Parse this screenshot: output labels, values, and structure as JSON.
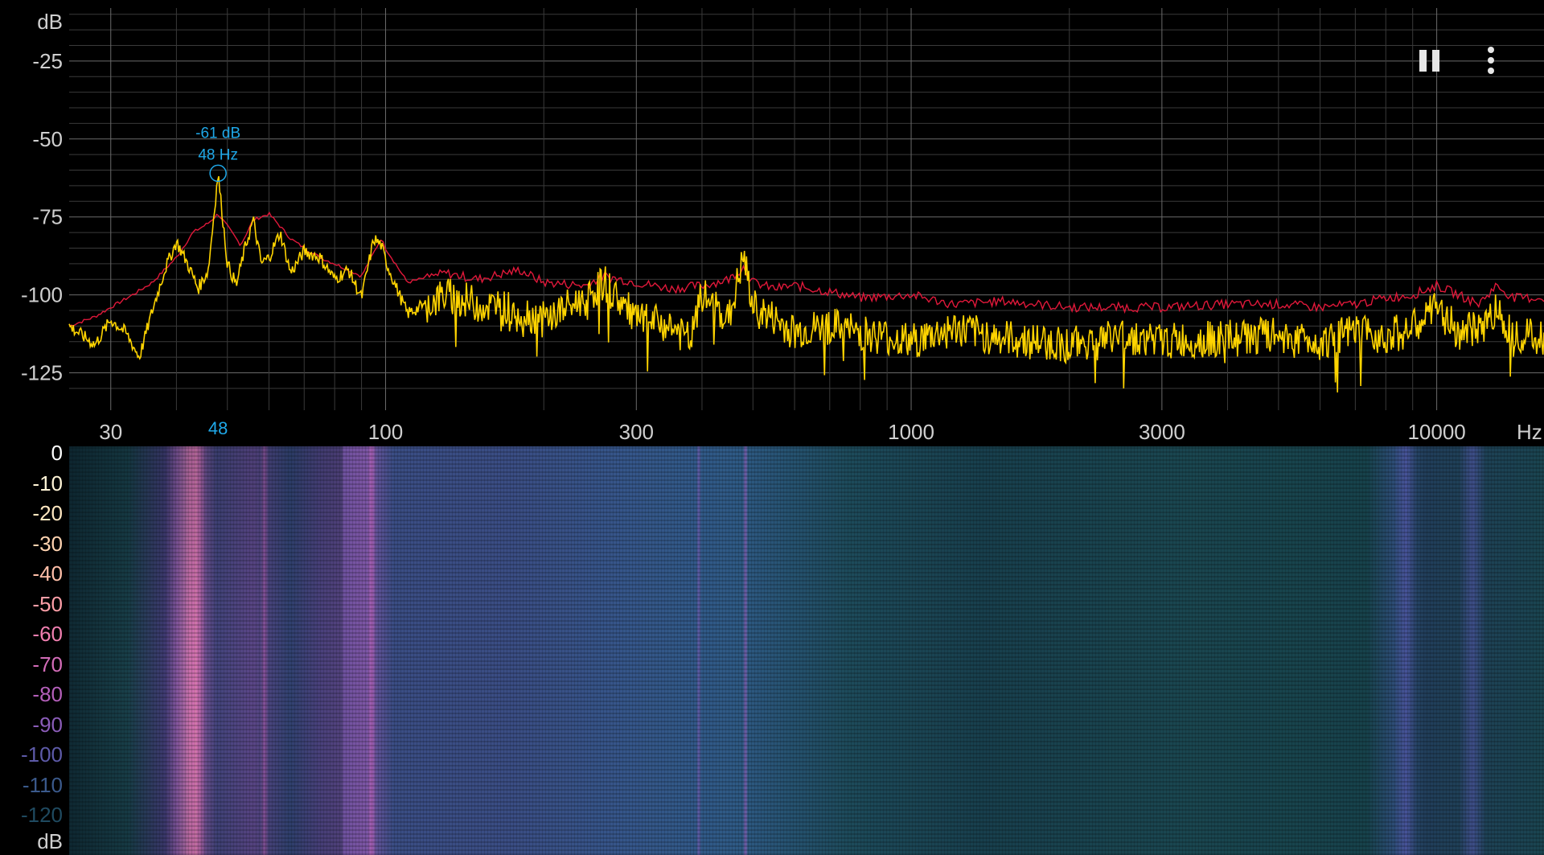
{
  "spectrum": {
    "db_unit": "dB",
    "freq_unit": "Hz",
    "y_ticks": [
      "-25",
      "-50",
      "-75",
      "-100",
      "-125"
    ],
    "x_ticks": [
      "30",
      "100",
      "300",
      "1000",
      "3000",
      "10000"
    ],
    "peak": {
      "db_label": "-61 dB",
      "freq_label": "48 Hz",
      "freq_tick": "48",
      "freq_hz": 48,
      "db": -61
    }
  },
  "controls": {
    "pause_icon": "pause-icon",
    "menu_icon": "more-vert-icon"
  },
  "colorbar": {
    "unit": "dB",
    "labels": [
      "0",
      "-10",
      "-20",
      "-30",
      "-40",
      "-50",
      "-60",
      "-70",
      "-80",
      "-90",
      "-100",
      "-110",
      "-120"
    ],
    "colors": [
      "#ffffff",
      "#fff4d6",
      "#ffe7c0",
      "#ffd3b0",
      "#ffbfa8",
      "#ff9fa8",
      "#f07fb0",
      "#d36cb8",
      "#b45fba",
      "#8a5cb8",
      "#5d5aa8",
      "#3b5a8c",
      "#1f4a60"
    ]
  },
  "colors": {
    "background": "#000000",
    "grid": "#3a3a3a",
    "grid_major": "#6a6a6a",
    "axis_text": "#cfcfcf",
    "peak_trace": "#e0183a",
    "current_trace": "#ffd400",
    "marker": "#1fa8e8"
  },
  "chart_data": {
    "type": "line",
    "xscale": "log",
    "xlim": [
      25,
      16000
    ],
    "ylim": [
      -137,
      -8
    ],
    "xlabel": "Hz",
    "ylabel": "dB",
    "series": [
      {
        "x": [
          25,
          28,
          30,
          33,
          36,
          40,
          43,
          46,
          48,
          50,
          53,
          56,
          60,
          63,
          66,
          70,
          75,
          80,
          90,
          98,
          100,
          110,
          130,
          150,
          180,
          200,
          240,
          260,
          300,
          350,
          400,
          450,
          480,
          500,
          550,
          600,
          700,
          800,
          1000,
          1200,
          1500,
          2000,
          2500,
          3000,
          4000,
          5000,
          6000,
          7000,
          8000,
          9000,
          10000,
          11000,
          12000,
          13000,
          14000,
          16000
        ],
        "y": [
          -110,
          -107,
          -104,
          -100,
          -96,
          -88,
          -80,
          -77,
          -74,
          -78,
          -84,
          -76,
          -74,
          -78,
          -82,
          -85,
          -88,
          -90,
          -94,
          -82,
          -85,
          -96,
          -93,
          -95,
          -92,
          -96,
          -97,
          -94,
          -96,
          -98,
          -97,
          -95,
          -91,
          -96,
          -98,
          -97,
          -99,
          -101,
          -100,
          -103,
          -102,
          -104,
          -104,
          -104,
          -103,
          -103,
          -104,
          -103,
          -101,
          -100,
          -97,
          -100,
          -103,
          -97,
          -101,
          -101
        ]
      },
      {
        "x": [
          25,
          28,
          30,
          32,
          34,
          36,
          38,
          40,
          42,
          44,
          46,
          48,
          50,
          52,
          54,
          56,
          58,
          60,
          63,
          66,
          70,
          75,
          80,
          85,
          90,
          95,
          98,
          100,
          105,
          110,
          130,
          150,
          180,
          200,
          240,
          260,
          300,
          350,
          380,
          400,
          450,
          480,
          500,
          550,
          600,
          700,
          800,
          1000,
          1200,
          1500,
          2000,
          2500,
          3000,
          4000,
          5000,
          6000,
          7000,
          8000,
          9000,
          10000,
          11000,
          12000,
          13000,
          14000,
          16000
        ],
        "y": [
          -110,
          -116,
          -108,
          -112,
          -120,
          -105,
          -92,
          -83,
          -90,
          -98,
          -92,
          -61,
          -90,
          -97,
          -85,
          -76,
          -90,
          -88,
          -80,
          -93,
          -86,
          -88,
          -95,
          -92,
          -101,
          -82,
          -84,
          -89,
          -98,
          -106,
          -100,
          -103,
          -105,
          -108,
          -101,
          -96,
          -108,
          -110,
          -115,
          -100,
          -108,
          -88,
          -104,
          -108,
          -112,
          -110,
          -112,
          -115,
          -111,
          -114,
          -116,
          -113,
          -115,
          -114,
          -113,
          -115,
          -112,
          -113,
          -111,
          -104,
          -112,
          -111,
          -105,
          -112,
          -114
        ]
      }
    ]
  }
}
